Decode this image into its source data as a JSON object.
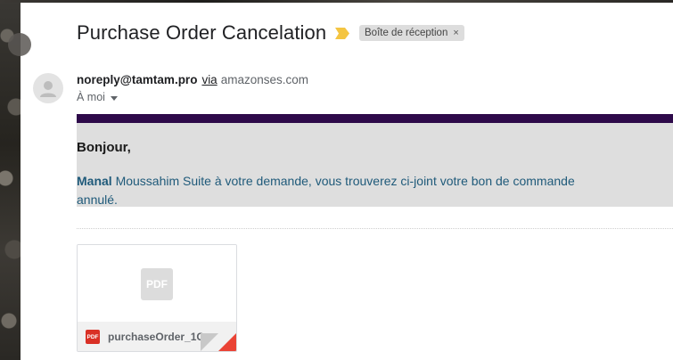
{
  "email": {
    "subject": "Purchase Order Cancelation",
    "label_chip": "Boîte de réception",
    "chip_close": "×",
    "sender_email": "noreply@tamtam.pro",
    "via_text": "via",
    "via_domain": "amazonses.com",
    "recipient": "À moi"
  },
  "body": {
    "greeting": "Bonjour,",
    "name": "Manal",
    "message": " Moussahim Suite à votre demande, vous trouverez ci-joint votre bon de commande annulé."
  },
  "attachment": {
    "preview_icon_text": "PDF",
    "file_type_text": "PDF",
    "filename": "purchaseOrder_1C..."
  },
  "colors": {
    "purple_bar": "#2e0a4a",
    "body_bg": "#dedede",
    "message_text": "#1f5a7a",
    "pdf_red": "#d93025",
    "important_marker": "#f4c542"
  },
  "icons": {
    "important": "important-marker-icon",
    "avatar": "person-icon",
    "recipient_caret": "caret-down-icon",
    "chip_close": "close-icon",
    "attachment_preview": "pdf-icon",
    "attachment_type": "pdf-file-icon"
  }
}
